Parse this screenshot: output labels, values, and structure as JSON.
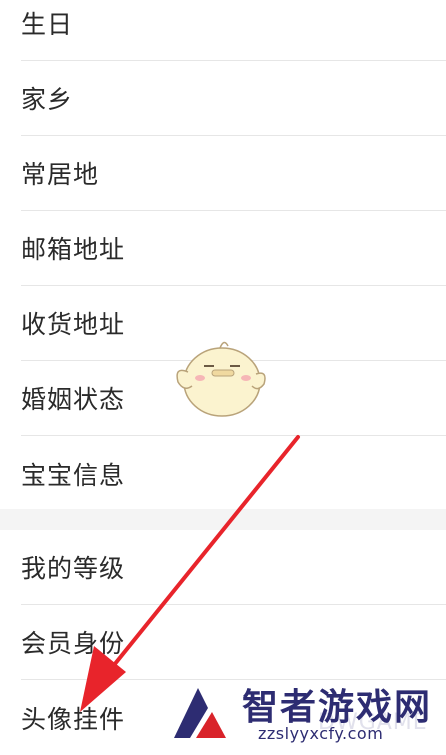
{
  "settings_list": {
    "group1": [
      {
        "label": "生日"
      },
      {
        "label": "家乡"
      },
      {
        "label": "常居地"
      },
      {
        "label": "邮箱地址"
      },
      {
        "label": "收货地址"
      },
      {
        "label": "婚姻状态"
      },
      {
        "label": "宝宝信息"
      }
    ],
    "group2": [
      {
        "label": "我的等级"
      },
      {
        "label": "会员身份"
      },
      {
        "label": "头像挂件"
      }
    ]
  },
  "watermark": {
    "title": "智者游戏网",
    "url": "zzslyyxcfy.com",
    "ghost_text": "DWGAME"
  },
  "annotation": {
    "arrow_color": "#e8242b",
    "mascot": "chick-mascot-icon"
  }
}
